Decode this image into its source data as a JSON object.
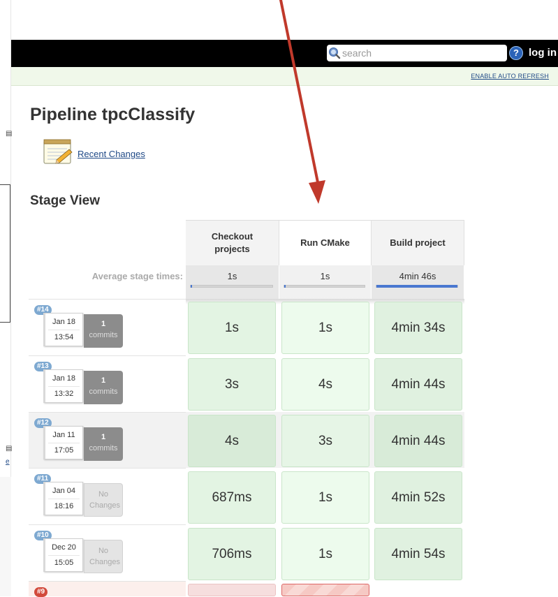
{
  "header": {
    "search_placeholder": "search",
    "help_label": "?",
    "login_label": "log in"
  },
  "subbar": {
    "auto_refresh_label": "ENABLE AUTO REFRESH"
  },
  "page": {
    "title": "Pipeline tpcClassify",
    "recent_changes_label": "Recent Changes",
    "stage_view_title": "Stage View"
  },
  "stages": [
    {
      "name": "Checkout projects",
      "avg_time": "1s",
      "avg_fraction": 0.01
    },
    {
      "name": "Run CMake",
      "avg_time": "1s",
      "avg_fraction": 0.01
    },
    {
      "name": "Build project",
      "avg_time": "4min 46s",
      "avg_fraction": 1.0
    }
  ],
  "avg_label": "Average stage times:",
  "runs": [
    {
      "id": "#14",
      "date": "Jan 18",
      "time": "13:54",
      "changes_count": "1",
      "changes_label": "commits",
      "durations": [
        "1s",
        "1s",
        "4min 34s"
      ]
    },
    {
      "id": "#13",
      "date": "Jan 18",
      "time": "13:32",
      "changes_count": "1",
      "changes_label": "commits",
      "durations": [
        "3s",
        "4s",
        "4min 44s"
      ]
    },
    {
      "id": "#12",
      "date": "Jan 11",
      "time": "17:05",
      "changes_count": "1",
      "changes_label": "commits",
      "durations": [
        "4s",
        "3s",
        "4min 44s"
      ]
    },
    {
      "id": "#11",
      "date": "Jan 04",
      "time": "18:16",
      "changes_count": "",
      "changes_label": "No Changes",
      "durations": [
        "687ms",
        "1s",
        "4min 52s"
      ]
    },
    {
      "id": "#10",
      "date": "Dec 20",
      "time": "15:05",
      "changes_count": "",
      "changes_label": "No Changes",
      "durations": [
        "706ms",
        "1s",
        "4min 54s"
      ]
    },
    {
      "id": "#9"
    }
  ],
  "left_strip": {
    "mark_top": "s",
    "mark_bottom": "e"
  }
}
